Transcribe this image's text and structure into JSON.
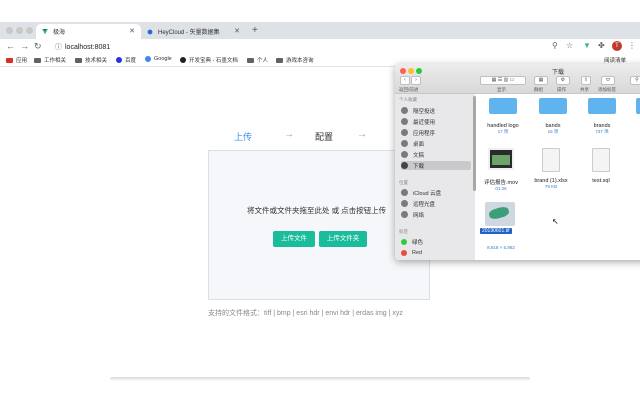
{
  "browser": {
    "tabs": [
      {
        "title": "极海",
        "active": true
      },
      {
        "title": "HeyCloud - 矢量数据集",
        "active": false
      }
    ],
    "url": "localhost:8081",
    "avatar_letter": "T",
    "bookmarks": [
      "应用",
      "工作相关",
      "技术相关",
      "百度",
      "Google",
      "开发宝典 - 石墨文档",
      "个人",
      "游戏本咨询"
    ],
    "reading_list": "阅读清单"
  },
  "page": {
    "steps": {
      "upload": "上传",
      "config": "配置",
      "arrow": "→"
    },
    "drop_text": "将文件或文件夹拖至此处 或 点击按钮上传",
    "btn_upload_file": "上传文件",
    "btn_upload_folder": "上传文件夹",
    "formats": "支持的文件格式：tiff | bmp | esri hdr | envi hdr | erdas img | xyz",
    "accent_color": "#1abc9c",
    "step_active_color": "#3a8ee6"
  },
  "finder": {
    "title": "下载",
    "toolbar_labels": {
      "back": "返回/前进",
      "view": "显示",
      "group": "群组",
      "action": "操作",
      "share": "共享",
      "tags": "添加标签"
    },
    "sidebar": {
      "favorites_header": "个人收藏",
      "favorites": [
        "隔空投送",
        "最近使用",
        "应用程序",
        "桌面",
        "文稿",
        "下载"
      ],
      "location_header": "位置",
      "locations": [
        "iCloud 云盘",
        "远程光盘",
        "网络"
      ],
      "tags_header": "标签",
      "tags": [
        "绿色",
        "Red"
      ]
    },
    "files": [
      {
        "name": "handled logo",
        "meta": "17 项"
      },
      {
        "name": "bands",
        "meta": "16 项"
      },
      {
        "name": "brands",
        "meta": "737 项"
      },
      {
        "name": "评估报告.mov",
        "meta": "01:26"
      },
      {
        "name": "brand (1).xlsx",
        "meta": "79 KB"
      },
      {
        "name": "test.sql",
        "meta": ""
      },
      {
        "name": "20190601.tif",
        "meta": "8,818 × 5,882"
      }
    ]
  }
}
